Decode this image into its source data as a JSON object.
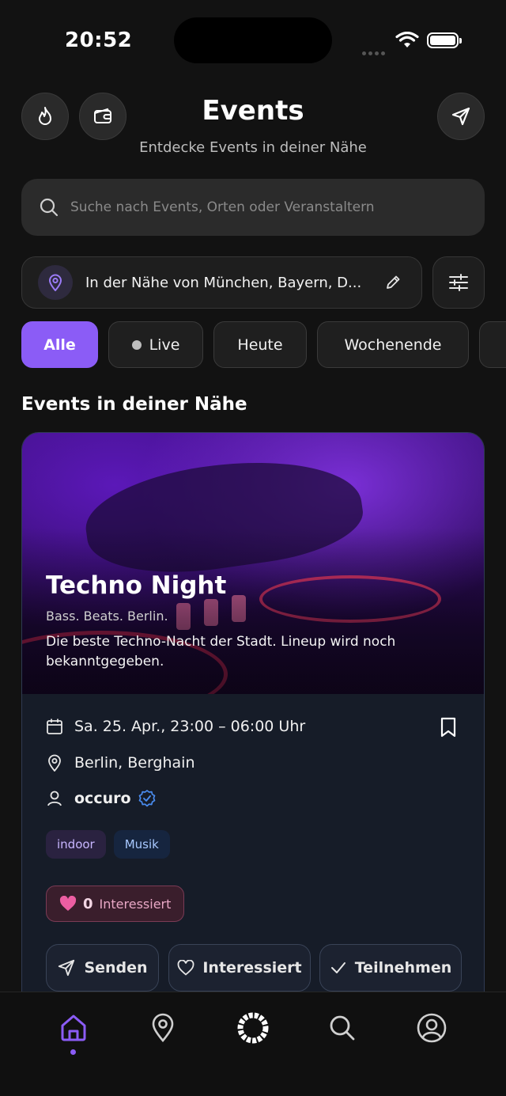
{
  "status_bar": {
    "time": "20:52"
  },
  "header": {
    "title": "Events",
    "subtitle": "Entdecke Events in deiner Nähe",
    "left_buttons": [
      "flame-icon",
      "wallet-icon"
    ],
    "right_button": "send-icon"
  },
  "search": {
    "placeholder": "Suche nach Events, Orten oder Veranstaltern"
  },
  "location": {
    "label": "In der Nähe von München, Bayern, D..."
  },
  "filters": {
    "chips": [
      "Alle",
      "Live",
      "Heute",
      "Wochenende"
    ],
    "active": "Alle"
  },
  "section": {
    "title": "Events in deiner Nähe"
  },
  "event": {
    "title": "Techno Night",
    "tagline": "Bass. Beats. Berlin.",
    "description": "Die beste Techno-Nacht der Stadt. Lineup wird noch bekanntgegeben.",
    "date": "Sa. 25. Apr., 23:00 – 06:00 Uhr",
    "location": "Berlin, Berghain",
    "organizer": "occuro",
    "tags": [
      "indoor",
      "Musik"
    ],
    "interested_count": "0",
    "interested_label": "Interessiert",
    "actions": {
      "send": "Senden",
      "interested": "Interessiert",
      "attend": "Teilnehmen"
    }
  },
  "colors": {
    "accent": "#8b5cf6",
    "background": "#121212",
    "card": "#161c28",
    "verified": "#4a8cf0"
  },
  "nav": {
    "items": [
      "home-icon",
      "map-pin-icon",
      "logo-icon",
      "search-icon",
      "profile-icon"
    ],
    "active": "home-icon"
  }
}
